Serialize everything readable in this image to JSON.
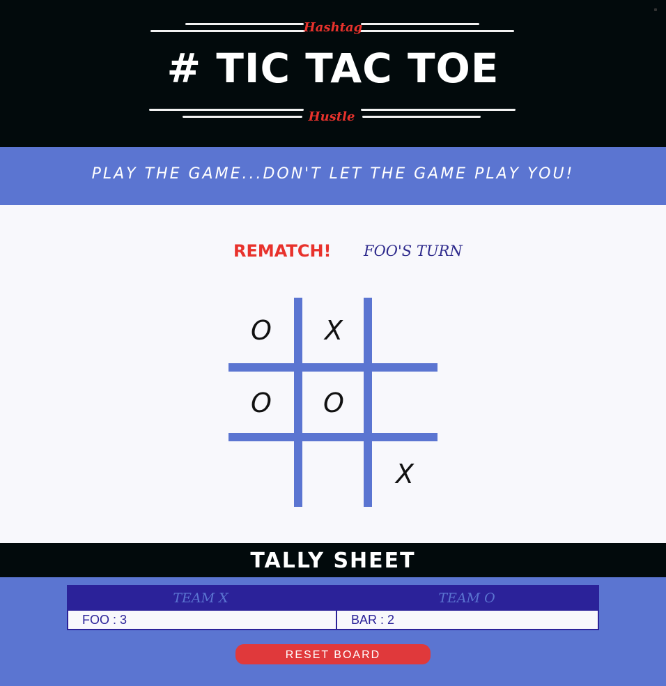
{
  "logo": {
    "top_text": "Hashtag",
    "title": "# TIC TAC TOE",
    "bottom_text": "Hustle"
  },
  "tagline": "PLAY THE GAME...DON'T LET THE GAME PLAY YOU!",
  "status": {
    "message": "REMATCH!",
    "turn": "FOO'S TURN"
  },
  "board": {
    "cells": [
      "O",
      "X",
      "",
      "O",
      "O",
      "",
      "",
      "",
      "X"
    ]
  },
  "tally": {
    "title": "TALLY SHEET",
    "headers": [
      "TEAM X",
      "TEAM O"
    ],
    "rows": [
      "FOO : 3",
      "BAR : 2"
    ]
  },
  "reset_label": "RESET  BOARD",
  "colors": {
    "accent_blue": "#5b75d1",
    "dark_navy": "#2b2299",
    "red": "#e0393b",
    "black": "#020a0c"
  }
}
